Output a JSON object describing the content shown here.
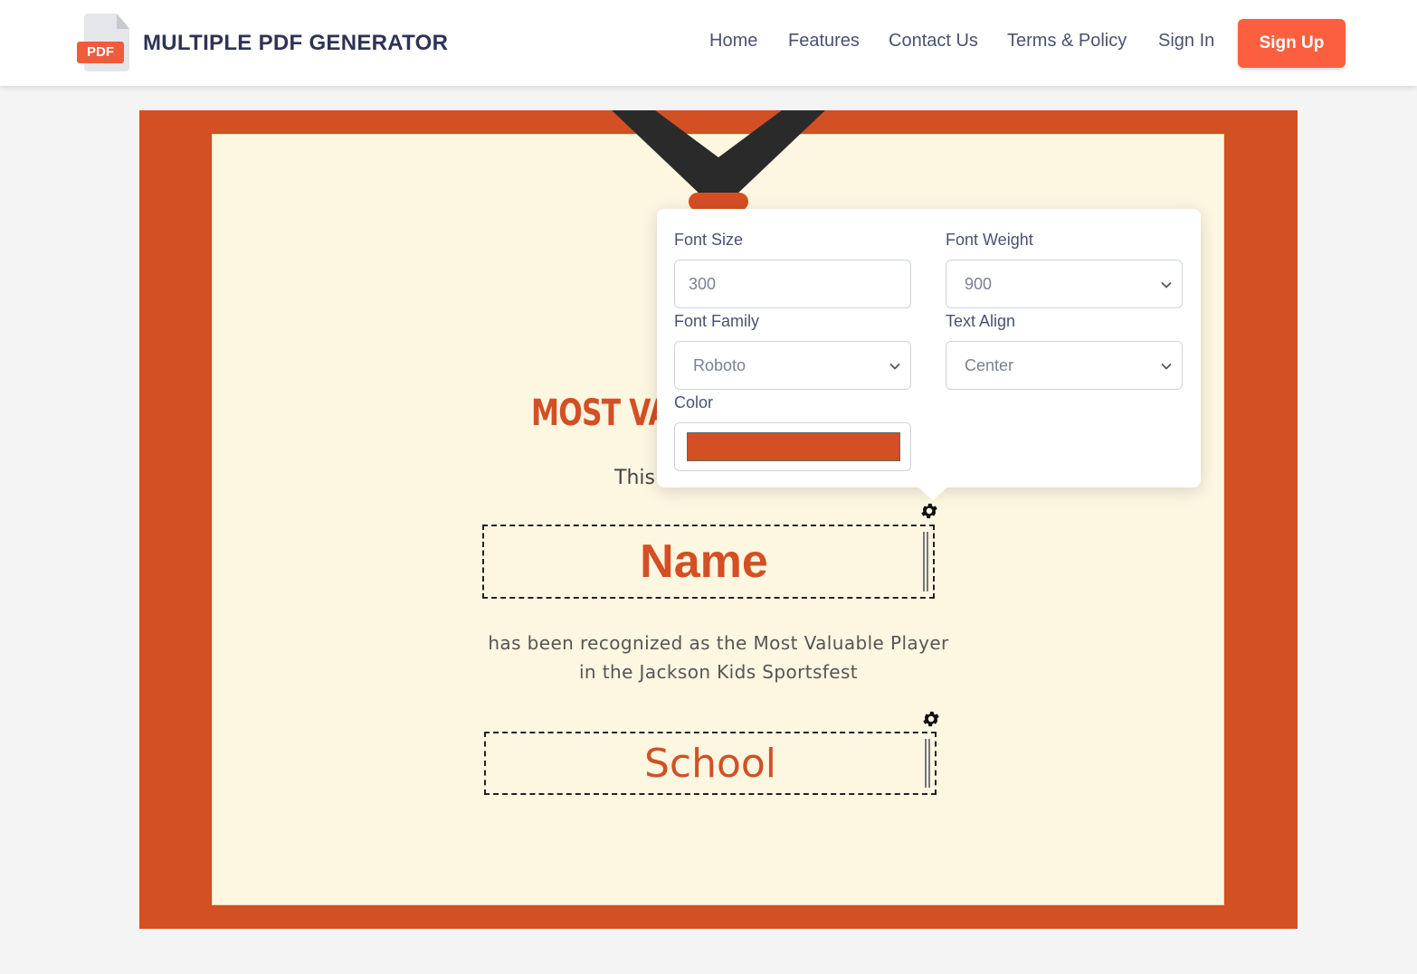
{
  "header": {
    "brand_name": "MULTIPLE PDF GENERATOR",
    "logo_tag": "PDF",
    "nav": [
      "Home",
      "Features",
      "Contact Us",
      "Terms & Policy",
      "Sign In"
    ],
    "signup_label": "Sign Up"
  },
  "certificate": {
    "title": "MOST VA",
    "subtitle": "This",
    "name_field": "Name",
    "body_line1": "has been recognized as the Most Valuable Player",
    "body_line2": "in the Jackson Kids Sportsfest",
    "school_field": "School"
  },
  "popover": {
    "font_size_label": "Font Size",
    "font_size_value": "300",
    "font_weight_label": "Font Weight",
    "font_weight_value": "900",
    "font_family_label": "Font Family",
    "font_family_value": "Roboto",
    "text_align_label": "Text Align",
    "text_align_value": "Center",
    "color_label": "Color",
    "color_value": "#d34f24"
  },
  "colors": {
    "accent": "#fc5f3f",
    "certificate_border": "#d34f24",
    "certificate_bg": "#fdf6e1",
    "lanyard": "#2a2a2a"
  },
  "icons": [
    "pdf-logo-icon",
    "gear-icon",
    "chevron-down-icon",
    "resize-handle-icon"
  ]
}
